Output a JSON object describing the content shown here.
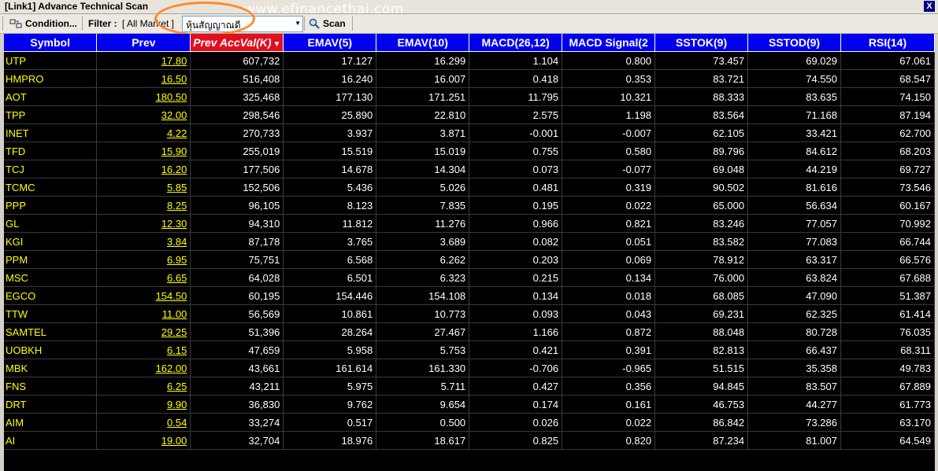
{
  "window": {
    "title": "[Link1] Advance Technical Scan",
    "close": "X",
    "watermark": "www.efinancethai.com"
  },
  "toolbar": {
    "condition_label": "Condition...",
    "filter_label": "Filter :",
    "filter_value": "[ All Market ]",
    "combo_value": "หุ้นสัญญาณดี",
    "scan_label": "Scan"
  },
  "colors": {
    "header_bg": "#0000ee",
    "sorted_header_bg": "#e01020",
    "symbol_text": "#ffff00",
    "highlight_ring": "#ff8a2a"
  },
  "table": {
    "columns": [
      "Symbol",
      "Prev",
      "Prev AccVal(K)",
      "EMAV(5)",
      "EMAV(10)",
      "MACD(26,12)",
      "MACD Signal(2",
      "SSTOK(9)",
      "SSTOD(9)",
      "RSI(14)"
    ],
    "sorted_column": 2,
    "rows": [
      [
        "UTP",
        "17.80",
        "607,732",
        "17.127",
        "16.299",
        "1.104",
        "0.800",
        "73.457",
        "69.029",
        "67.061"
      ],
      [
        "HMPRO",
        "16.50",
        "516,408",
        "16.240",
        "16.007",
        "0.418",
        "0.353",
        "83.721",
        "74.550",
        "68.547"
      ],
      [
        "AOT",
        "180.50",
        "325,468",
        "177.130",
        "171.251",
        "11.795",
        "10.321",
        "88.333",
        "83.635",
        "74.150"
      ],
      [
        "TPP",
        "32.00",
        "298,546",
        "25.890",
        "22.810",
        "2.575",
        "1.198",
        "83.564",
        "71.168",
        "87.194"
      ],
      [
        "INET",
        "4.22",
        "270,733",
        "3.937",
        "3.871",
        "-0.001",
        "-0.007",
        "62.105",
        "33.421",
        "62.700"
      ],
      [
        "TFD",
        "15.90",
        "255,019",
        "15.519",
        "15.019",
        "0.755",
        "0.580",
        "89.796",
        "84.612",
        "68.203"
      ],
      [
        "TCJ",
        "16.20",
        "177,506",
        "14.678",
        "14.304",
        "0.073",
        "-0.077",
        "69.048",
        "44.219",
        "69.727"
      ],
      [
        "TCMC",
        "5.85",
        "152,506",
        "5.436",
        "5.026",
        "0.481",
        "0.319",
        "90.502",
        "81.616",
        "73.546"
      ],
      [
        "PPP",
        "8.25",
        "96,105",
        "8.123",
        "7.835",
        "0.195",
        "0.022",
        "65.000",
        "56.634",
        "60.167"
      ],
      [
        "GL",
        "12.30",
        "94,310",
        "11.812",
        "11.276",
        "0.966",
        "0.821",
        "83.246",
        "77.057",
        "70.992"
      ],
      [
        "KGI",
        "3.84",
        "87,178",
        "3.765",
        "3.689",
        "0.082",
        "0.051",
        "83.582",
        "77.083",
        "66.744"
      ],
      [
        "PPM",
        "6.95",
        "75,751",
        "6.568",
        "6.262",
        "0.203",
        "0.069",
        "78.912",
        "63.317",
        "66.576"
      ],
      [
        "MSC",
        "6.65",
        "64,028",
        "6.501",
        "6.323",
        "0.215",
        "0.134",
        "76.000",
        "63.824",
        "67.688"
      ],
      [
        "EGCO",
        "154.50",
        "60,195",
        "154.446",
        "154.108",
        "0.134",
        "0.018",
        "68.085",
        "47.090",
        "51.387"
      ],
      [
        "TTW",
        "11.00",
        "56,569",
        "10.861",
        "10.773",
        "0.093",
        "0.043",
        "69.231",
        "62.325",
        "61.414"
      ],
      [
        "SAMTEL",
        "29.25",
        "51,396",
        "28.264",
        "27.467",
        "1.166",
        "0.872",
        "88.048",
        "80.728",
        "76.035"
      ],
      [
        "UOBKH",
        "6.15",
        "47,659",
        "5.958",
        "5.753",
        "0.421",
        "0.391",
        "82.813",
        "66.437",
        "68.311"
      ],
      [
        "MBK",
        "162.00",
        "43,661",
        "161.614",
        "161.330",
        "-0.706",
        "-0.965",
        "51.515",
        "35.358",
        "49.783"
      ],
      [
        "FNS",
        "6.25",
        "43,211",
        "5.975",
        "5.711",
        "0.427",
        "0.356",
        "94.845",
        "83.507",
        "67.889"
      ],
      [
        "DRT",
        "9.90",
        "36,830",
        "9.762",
        "9.654",
        "0.174",
        "0.161",
        "46.753",
        "44.277",
        "61.773"
      ],
      [
        "AIM",
        "0.54",
        "33,274",
        "0.517",
        "0.500",
        "0.026",
        "0.022",
        "86.842",
        "73.286",
        "63.170"
      ],
      [
        "AI",
        "19.00",
        "32,704",
        "18.976",
        "18.617",
        "0.825",
        "0.820",
        "87.234",
        "81.007",
        "64.549"
      ]
    ]
  }
}
